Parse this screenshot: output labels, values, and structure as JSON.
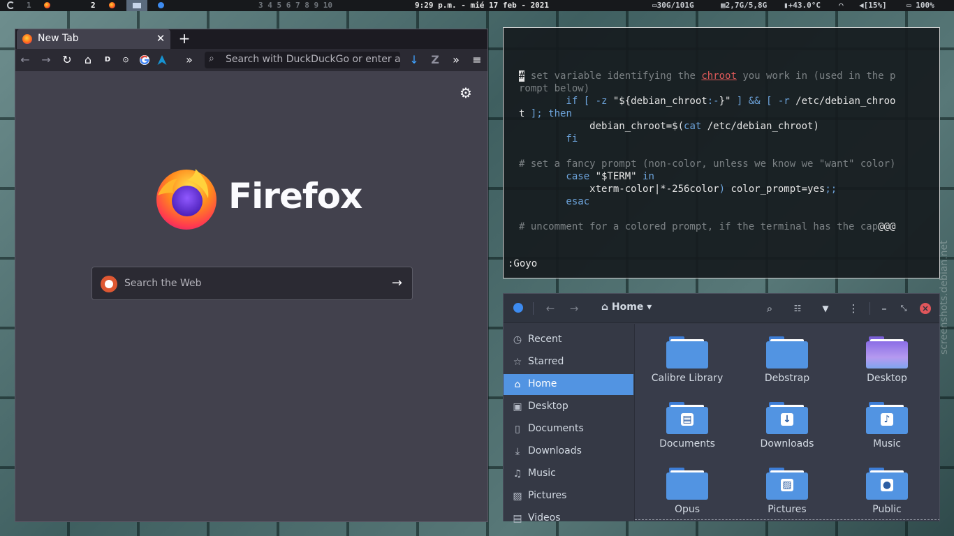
{
  "topbar": {
    "workspaces_left": [
      "1",
      "2"
    ],
    "workspaces_right": "3 4 5 6 7 8 9 10",
    "clock": "9:29 p.m. - mié 17 feb - 2021",
    "disk": "30G/101G",
    "memory": "2,7G/5,8G",
    "temperature": "+43.0°C",
    "volume": "[15%]",
    "battery": "100%"
  },
  "firefox": {
    "tab_title": "New Tab",
    "tab_close": "✕",
    "new_tab": "+",
    "urlbar_placeholder": "Search with DuckDuckGo or enter address",
    "wordmark": "Firefox",
    "search_placeholder": "Search the Web",
    "toolbar_glyphs": {
      "back": "←",
      "forward": "→",
      "reload": "↻",
      "home": "⌂",
      "d_ext": "D",
      "overflow": "»",
      "download": "↓",
      "menu": "≡"
    }
  },
  "terminal": {
    "lines": [
      [
        [
          "cursor",
          "#"
        ],
        [
          "comment",
          " set variable identifying the "
        ],
        [
          "red",
          "chroot"
        ],
        [
          "comment",
          " you work in (used in the p"
        ]
      ],
      [
        [
          "comment",
          "rompt below)"
        ]
      ],
      [
        [
          "kw",
          "        if [ -z "
        ],
        [
          "str",
          "\"${debian_chroot"
        ],
        [
          "kw",
          ":-"
        ],
        [
          "str",
          "}\""
        ],
        [
          "kw",
          " ] && [ -r "
        ],
        [
          "str",
          "/etc/debian_chroo"
        ]
      ],
      [
        [
          "str",
          "t"
        ],
        [
          "kw",
          " ]; then"
        ]
      ],
      [
        [
          "str",
          "            debian_chroot=$("
        ],
        [
          "kw",
          "cat"
        ],
        [
          "str",
          " /etc/debian_chroot)"
        ]
      ],
      [
        [
          "kw",
          "        fi"
        ]
      ],
      [
        [
          "str",
          ""
        ]
      ],
      [
        [
          "comment",
          "# set a fancy prompt (non-color, unless we know we \"want\" color)"
        ]
      ],
      [
        [
          "kw",
          "        case "
        ],
        [
          "str",
          "\"$TERM\""
        ],
        [
          "kw",
          " in"
        ]
      ],
      [
        [
          "str",
          "            xterm-color|*-256color"
        ],
        [
          "kw",
          ")"
        ],
        [
          "str",
          " color_prompt=yes"
        ],
        [
          "kw",
          ";;"
        ]
      ],
      [
        [
          "kw",
          "        esac"
        ]
      ],
      [
        [
          "str",
          ""
        ]
      ],
      [
        [
          "comment",
          "# uncomment for a colored prompt, if the terminal has the cap"
        ],
        [
          "str",
          "@@@"
        ]
      ]
    ],
    "command": ":Goyo"
  },
  "files": {
    "location": "Home",
    "sidebar": [
      {
        "icon": "clock-icon",
        "glyph": "◷",
        "label": "Recent",
        "active": false
      },
      {
        "icon": "star-icon",
        "glyph": "☆",
        "label": "Starred",
        "active": false
      },
      {
        "icon": "home-icon",
        "glyph": "⌂",
        "label": "Home",
        "active": true
      },
      {
        "icon": "desktop-icon",
        "glyph": "▣",
        "label": "Desktop",
        "active": false
      },
      {
        "icon": "document-icon",
        "glyph": "▯",
        "label": "Documents",
        "active": false
      },
      {
        "icon": "download-icon",
        "glyph": "⤓",
        "label": "Downloads",
        "active": false
      },
      {
        "icon": "music-icon",
        "glyph": "♫",
        "label": "Music",
        "active": false
      },
      {
        "icon": "picture-icon",
        "glyph": "▨",
        "label": "Pictures",
        "active": false
      },
      {
        "icon": "video-icon",
        "glyph": "▤",
        "label": "Videos",
        "active": false
      }
    ],
    "folders": [
      {
        "name": "Calibre Library",
        "glyph": "",
        "kind": "plain"
      },
      {
        "name": "Debstrap",
        "glyph": "",
        "kind": "plain"
      },
      {
        "name": "Desktop",
        "glyph": "",
        "kind": "desktop"
      },
      {
        "name": "Documents",
        "glyph": "▤",
        "kind": "plain"
      },
      {
        "name": "Downloads",
        "glyph": "↓",
        "kind": "plain"
      },
      {
        "name": "Music",
        "glyph": "♪",
        "kind": "plain"
      },
      {
        "name": "Opus",
        "glyph": "",
        "kind": "plain"
      },
      {
        "name": "Pictures",
        "glyph": "▨",
        "kind": "plain"
      },
      {
        "name": "Public",
        "glyph": "●",
        "kind": "plain"
      }
    ]
  },
  "watermark": "screenshots.debian.net"
}
